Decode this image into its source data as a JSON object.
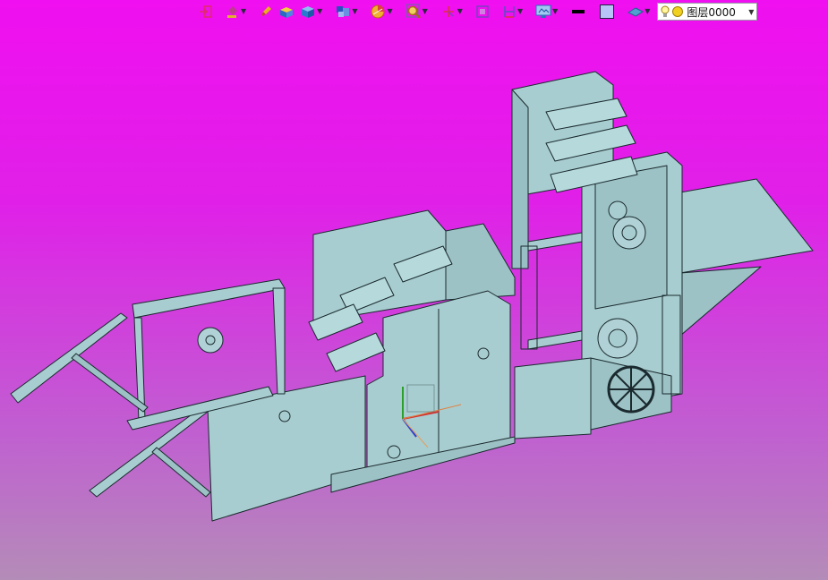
{
  "toolbar": {
    "icons": [
      {
        "name": "exit-icon",
        "color": "#e02a6a",
        "dropdown": false
      },
      {
        "name": "paint-bucket-icon",
        "color": "#c03a90",
        "dropdown": true
      },
      {
        "name": "pen-icon",
        "color": "#e8b020",
        "dropdown": false
      },
      {
        "name": "box-open-icon",
        "color": "#f0c020",
        "dropdown": false
      },
      {
        "name": "cube-view-icon",
        "color": "#2a7ad0",
        "dropdown": true
      },
      {
        "name": "multi-view-icon",
        "color": "#2a50c0",
        "dropdown": true
      },
      {
        "name": "section-icon",
        "color": "#e8a020",
        "dropdown": true
      },
      {
        "name": "zoom-icon",
        "color": "#d0a020",
        "dropdown": true
      },
      {
        "name": "orient-axes-icon",
        "color": "#e03040",
        "dropdown": true
      },
      {
        "name": "frame-icon",
        "color": "#7a40c0",
        "dropdown": false
      },
      {
        "name": "bracket-icon",
        "color": "#5a50c0",
        "dropdown": true
      },
      {
        "name": "display-icon",
        "color": "#3070c0",
        "dropdown": true
      },
      {
        "name": "line-weight-icon",
        "color": "#000000",
        "dropdown": false
      },
      {
        "name": "color-swatch-icon",
        "color": "#b8c4f8",
        "dropdown": false
      },
      {
        "name": "plane-icon",
        "color": "#50a0d0",
        "dropdown": true
      }
    ],
    "layer": {
      "label": "图层0000"
    }
  },
  "model": {
    "fill_color": "#a8cdd0",
    "edge_color": "#1a2a2e"
  }
}
